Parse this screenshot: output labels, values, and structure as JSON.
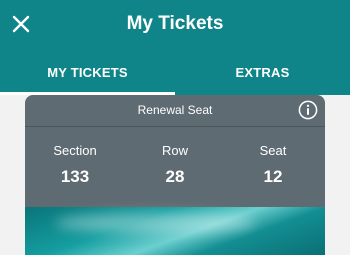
{
  "header": {
    "title": "My Tickets",
    "close_icon": "close-icon"
  },
  "tabs": [
    {
      "label": "MY TICKETS",
      "active": true
    },
    {
      "label": "EXTRAS",
      "active": false
    }
  ],
  "ticket": {
    "title": "Renewal Seat",
    "info_icon": "info-icon",
    "section_label": "Section",
    "section_value": "133",
    "row_label": "Row",
    "row_value": "28",
    "seat_label": "Seat",
    "seat_value": "12"
  },
  "colors": {
    "brand": "#0f858a",
    "ticket_bg": "#5f6b72"
  }
}
